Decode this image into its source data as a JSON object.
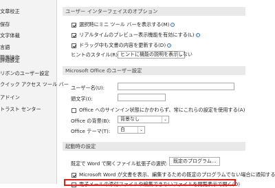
{
  "sidebar": {
    "items": [
      {
        "label": "文章校正"
      },
      {
        "label": "保存"
      },
      {
        "label": "文字体裁"
      },
      {
        "label": "言語"
      },
      {
        "label": "簡単操作"
      },
      {
        "label": "詳細設定"
      },
      {
        "label": "リボンのユーザー設定"
      },
      {
        "label": "クイック アクセス ツール バー"
      },
      {
        "label": "アドイン"
      },
      {
        "label": "トラスト センター"
      }
    ]
  },
  "ui_options": {
    "header": "ユーザー インターフェイスのオプション",
    "mini_toolbar": "選択時にミニ ツール バーを表示する(M)",
    "live_preview": "リアルタイムのプレビュー表示機能を有効にする(L)",
    "update_content": "ドラッグ中も文書の内容を更新する(D)",
    "tooltip_label": "ヒントのスタイル(R):",
    "tooltip_value": "ヒントに機能の説明を表示しない"
  },
  "personalize": {
    "header": "Microsoft Office のユーザー設定",
    "username_label": "ユーザー名(U):",
    "initials_label": "頭文字(I):",
    "always_use": "Office へのサインイン状態にかかわらず、常にこれらの設定を使用する(A)",
    "background_label": "Office の背景(B):",
    "background_value": "背景なし",
    "theme_label": "Office テーマ(T):",
    "theme_value": "白"
  },
  "startup": {
    "header": "起動時の設定",
    "extensions_label": "既定で Word で開くファイル拡張子の選択:",
    "default_programs_button": "既定のプログラム...",
    "tell_me": "Microsoft Word が文書を表示、編集するための既定のプログラムでない場合に通知する",
    "open_attachments": "電子メールの添付ファイルや編集できないファイルを閲覧表示で開く(O)"
  }
}
